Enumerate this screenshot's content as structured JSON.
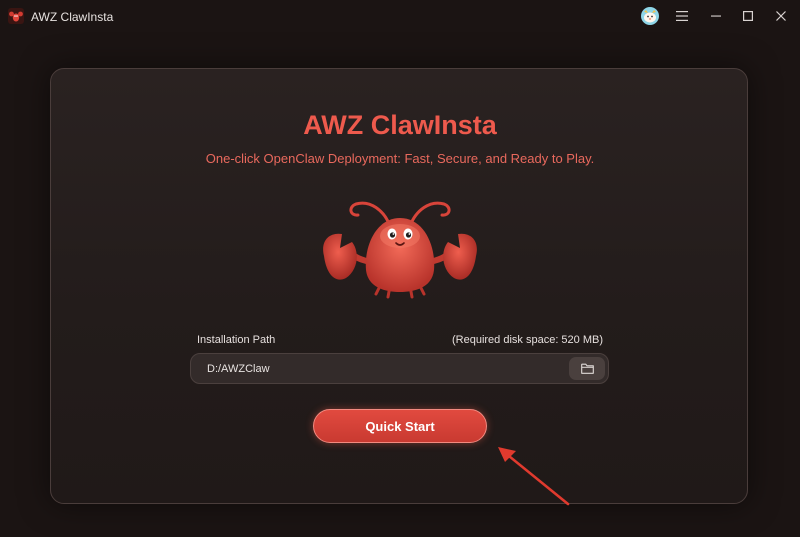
{
  "app": {
    "title": "AWZ ClawInsta",
    "logo_icon": "lobster-app-icon"
  },
  "titlebar": {
    "buttons": [
      {
        "name": "assistant-avatar-button",
        "icon": "mascot-face-icon"
      },
      {
        "name": "menu-button",
        "icon": "hamburger-icon"
      },
      {
        "name": "minimize-button",
        "icon": "minimize-icon"
      },
      {
        "name": "maximize-button",
        "icon": "maximize-icon"
      },
      {
        "name": "close-button",
        "icon": "close-icon"
      }
    ]
  },
  "main": {
    "headline": "AWZ ClawInsta",
    "subtitle": "One-click OpenClaw Deployment: Fast, Secure, and Ready to Play.",
    "mascot_icon": "lobster-mascot"
  },
  "install": {
    "path_label": "Installation Path",
    "disk_space": "(Required disk space: 520 MB)",
    "path_value": "D:/AWZClaw",
    "browse_icon": "folder-icon"
  },
  "actions": {
    "quick_start_label": "Quick Start"
  },
  "colors": {
    "accent": "#e14a3f",
    "headline": "#ee5a4d",
    "background": "#1b1413",
    "card": "#2a2221"
  }
}
